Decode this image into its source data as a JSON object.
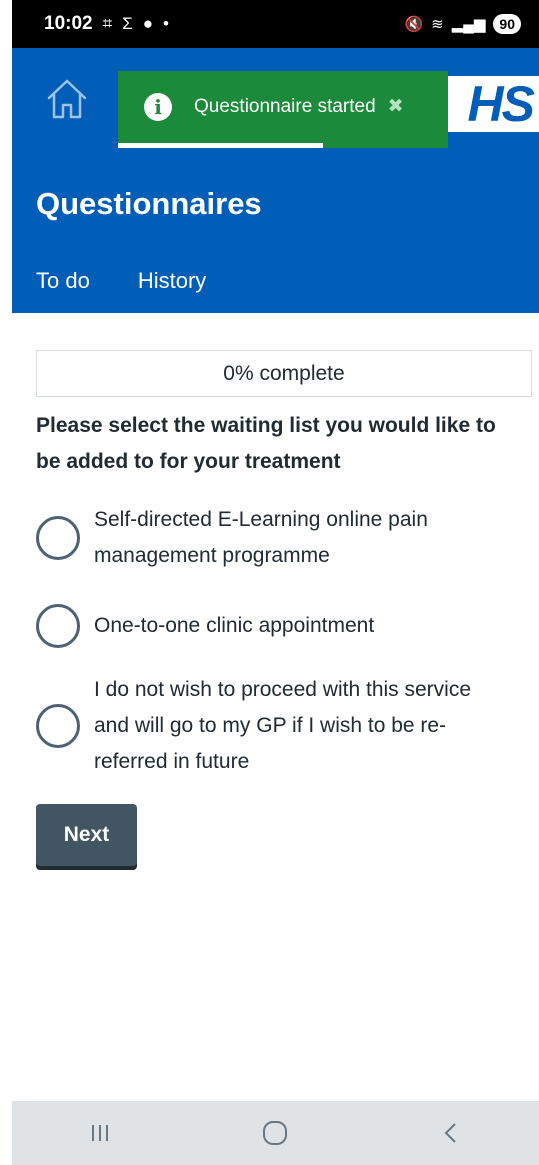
{
  "status_bar": {
    "time": "10:02",
    "battery": "90"
  },
  "header": {
    "logo_text": "HS",
    "title": "Questionnaires",
    "tabs": [
      {
        "label": "To do"
      },
      {
        "label": "History"
      }
    ]
  },
  "toast": {
    "message": "Questionnaire started",
    "close_glyph": "✖",
    "timer_remaining": 0.62
  },
  "main": {
    "progress_text": "0% complete",
    "question": "Please select the waiting list you would like to be added to for your treatment",
    "options": [
      {
        "label": "Self-directed E-Learning online pain management programme"
      },
      {
        "label": "One-to-one clinic appointment"
      },
      {
        "label": "I do not wish to proceed with this service and will go to my GP if I wish to be re-referred in future"
      }
    ],
    "next_label": "Next"
  },
  "colors": {
    "header_blue": "#005eb8",
    "toast_green": "#1b8a3a",
    "button_grey": "#425563"
  },
  "icons": [
    "home-icon",
    "info-icon",
    "close-icon",
    "recents-icon",
    "home-circle-icon",
    "back-icon"
  ]
}
